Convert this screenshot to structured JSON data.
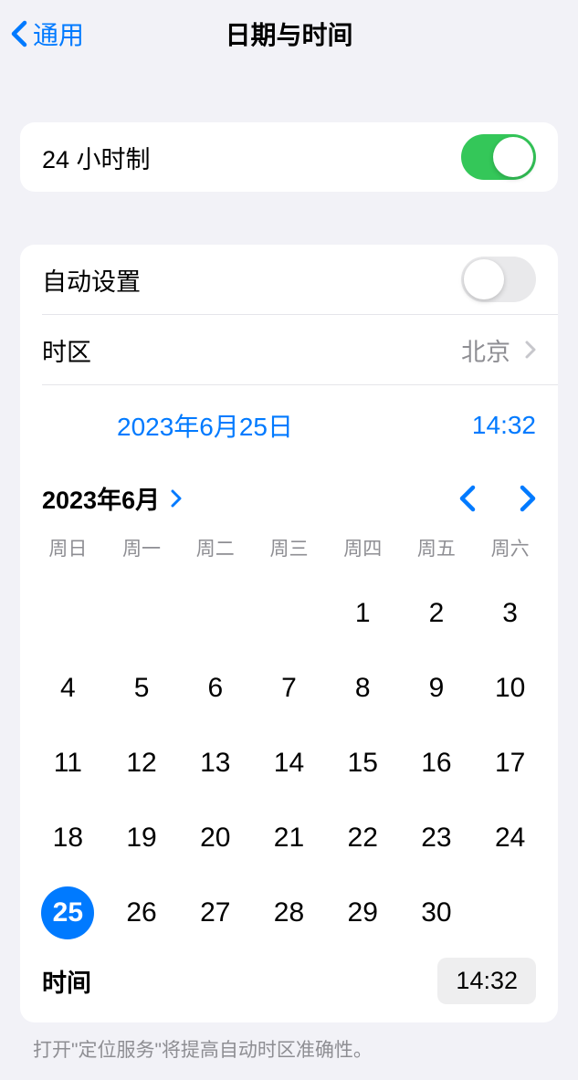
{
  "nav": {
    "back_label": "通用",
    "title": "日期与时间"
  },
  "section1": {
    "format24h_label": "24 小时制",
    "format24h_on": true
  },
  "section2": {
    "auto_set_label": "自动设置",
    "auto_set_on": false,
    "timezone_label": "时区",
    "timezone_value": "北京",
    "date_display": "2023年6月25日",
    "time_display": "14:32"
  },
  "calendar": {
    "month_title": "2023年6月",
    "weekdays": [
      "周日",
      "周一",
      "周二",
      "周三",
      "周四",
      "周五",
      "周六"
    ],
    "leading_blanks": 4,
    "days": [
      1,
      2,
      3,
      4,
      5,
      6,
      7,
      8,
      9,
      10,
      11,
      12,
      13,
      14,
      15,
      16,
      17,
      18,
      19,
      20,
      21,
      22,
      23,
      24,
      25,
      26,
      27,
      28,
      29,
      30
    ],
    "selected_day": 25
  },
  "time_row": {
    "label": "时间",
    "value": "14:32"
  },
  "footer": {
    "note": "打开\"定位服务\"将提高自动时区准确性。"
  },
  "colors": {
    "accent": "#007aff",
    "green": "#34c759",
    "gray": "#8e8e93"
  }
}
